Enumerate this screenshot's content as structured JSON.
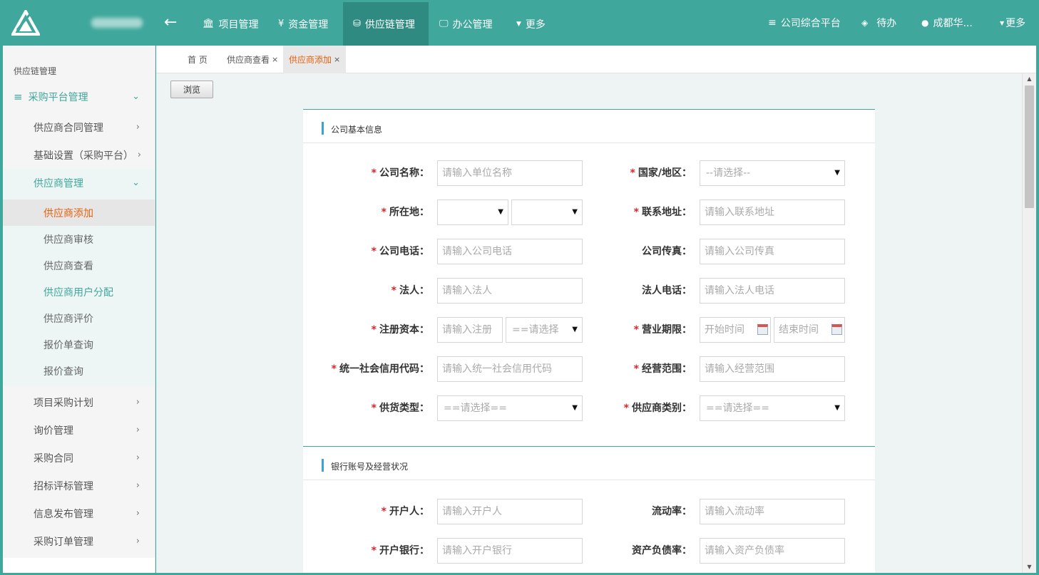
{
  "topbar": {
    "nav": [
      {
        "label": "项目管理",
        "icon": "bank-icon"
      },
      {
        "label": "资金管理",
        "icon": "yen-icon"
      },
      {
        "label": "供应链管理",
        "icon": "database-icon"
      },
      {
        "label": "办公管理",
        "icon": "monitor-icon"
      },
      {
        "label": "更多",
        "icon": "caret-down-icon"
      }
    ],
    "platform": "公司综合平台",
    "todo": "待办",
    "user": "成都华...",
    "more": "更多",
    "icon_glyphs": {
      "bank": "🏛",
      "yen": "¥",
      "database": "⛁",
      "monitor": "🖵",
      "menu": "≡",
      "bell": "🔔",
      "user": "👤"
    }
  },
  "sidebar": {
    "title": "供应链管理",
    "top_item": "采购平台管理",
    "items_before": [
      "供应商合同管理",
      "基础设置（采购平台）"
    ],
    "group_label": "供应商管理",
    "group_items": [
      "供应商添加",
      "供应商审核",
      "供应商查看",
      "供应商用户分配",
      "供应商评价",
      "报价单查询",
      "报价查询"
    ],
    "items_after": [
      "项目采购计划",
      "询价管理",
      "采购合同",
      "招标评标管理",
      "信息发布管理",
      "采购订单管理"
    ]
  },
  "tabs": [
    {
      "label": "首 页",
      "closable": false
    },
    {
      "label": "供应商查看",
      "closable": true
    },
    {
      "label": "供应商添加",
      "closable": true
    }
  ],
  "tab_close": "×",
  "browse_button": "浏览",
  "section1": {
    "title": "公司基本信息",
    "fields": {
      "company_name": {
        "label": "公司名称：",
        "required": true,
        "placeholder": "请输入单位名称"
      },
      "country": {
        "label": "国家/地区：",
        "required": true,
        "value": "--请选择--"
      },
      "location": {
        "label": "所在地：",
        "required": true,
        "value1": "",
        "value2": ""
      },
      "address": {
        "label": "联系地址：",
        "required": true,
        "placeholder": "请输入联系地址"
      },
      "phone": {
        "label": "公司电话：",
        "required": true,
        "placeholder": "请输入公司电话"
      },
      "fax": {
        "label": "公司传真：",
        "required": false,
        "placeholder": "请输入公司传真"
      },
      "legal_person": {
        "label": "法人：",
        "required": true,
        "placeholder": "请输入法人"
      },
      "legal_phone": {
        "label": "法人电话：",
        "required": false,
        "placeholder": "请输入法人电话"
      },
      "capital": {
        "label": "注册资本：",
        "required": true,
        "placeholder": "请输入注册",
        "unit": "==请选择"
      },
      "term": {
        "label": "营业期限：",
        "required": true,
        "start": "开始时间",
        "end": "结束时间"
      },
      "credit_code": {
        "label": "统一社会信用代码：",
        "required": true,
        "placeholder": "请输入统一社会信用代码"
      },
      "scope": {
        "label": "经营范围：",
        "required": true,
        "placeholder": "请输入经营范围"
      },
      "supply_type": {
        "label": "供货类型：",
        "required": true,
        "value": "==请选择=="
      },
      "supplier_category": {
        "label": "供应商类别：",
        "required": true,
        "value": "==请选择=="
      }
    }
  },
  "section2": {
    "title": "银行账号及经营状况",
    "fields": {
      "account_holder": {
        "label": "开户人：",
        "required": true,
        "placeholder": "请输入开户人"
      },
      "liquidity": {
        "label": "流动率：",
        "required": false,
        "placeholder": "请输入流动率"
      },
      "bank": {
        "label": "开户银行：",
        "required": true,
        "placeholder": "请输入开户银行"
      },
      "debt_ratio": {
        "label": "资产负债率：",
        "required": false,
        "placeholder": "请输入资产负债率"
      }
    }
  },
  "required_mark": "*",
  "colors": {
    "primary": "#3fa79c",
    "active_nav": "#2f8b82",
    "active_text": "#e8600c",
    "required": "#d9262c",
    "section_bar": "#3aa0e0"
  }
}
